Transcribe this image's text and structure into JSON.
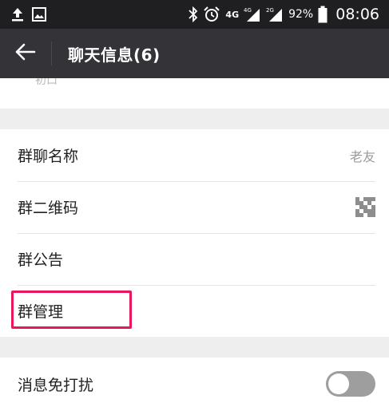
{
  "status_bar": {
    "network_4g_label": "4G",
    "network_4g_small": "4G",
    "network_2g_small": "2G",
    "battery_percent": "92%",
    "time": "08:06"
  },
  "header": {
    "back_icon": "arrow-left-icon",
    "title": "聊天信息(6)"
  },
  "partial_row": {
    "label": "初口"
  },
  "settings": {
    "group_name_label": "群聊名称",
    "group_name_value": "老友",
    "qr_code_label": "群二维码",
    "qr_icon": "qr-code-icon",
    "announcement_label": "群公告",
    "manage_label": "群管理",
    "mute_label": "消息免打扰",
    "mute_enabled": false
  },
  "colors": {
    "highlight": "#e8175d",
    "title_bar": "#333338",
    "status_bar": "#1f1f22"
  }
}
